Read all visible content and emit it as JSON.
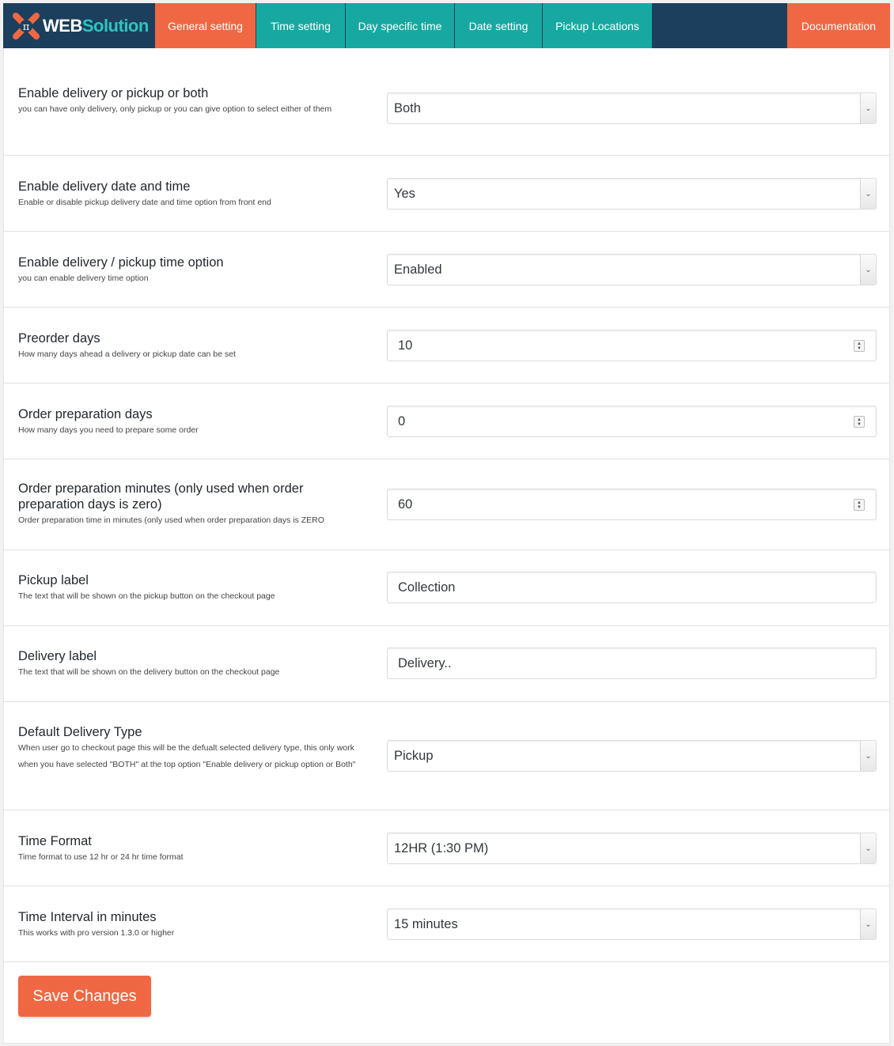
{
  "brand": {
    "part1": "WEB",
    "part2": "Solution"
  },
  "tabs": [
    {
      "label": "General setting"
    },
    {
      "label": "Time setting"
    },
    {
      "label": "Day specific time"
    },
    {
      "label": "Date setting"
    },
    {
      "label": "Pickup Locations"
    }
  ],
  "doc_tab": "Documentation",
  "settings": {
    "delivery_mode": {
      "title": "Enable delivery or pickup or both",
      "desc": "you can have only delivery, only pickup or you can give option to select either of them",
      "value": "Both"
    },
    "date_time": {
      "title": "Enable delivery date and time",
      "desc": "Enable or disable pickup delivery date and time option from front end",
      "value": "Yes"
    },
    "time_option": {
      "title": "Enable delivery / pickup time option",
      "desc": "you can enable delivery time option",
      "value": "Enabled"
    },
    "preorder": {
      "title": "Preorder days",
      "desc": "How many days ahead a delivery or pickup date can be set",
      "value": "10"
    },
    "prep_days": {
      "title": "Order preparation days",
      "desc": "How many days you need to prepare some order",
      "value": "0"
    },
    "prep_minutes": {
      "title": "Order preparation minutes (only used when order preparation days is zero)",
      "desc": "Order preparation time in minutes (only used when order preparation days is ZERO",
      "value": "60"
    },
    "pickup_label": {
      "title": "Pickup label",
      "desc": "The text that will be shown on the pickup button on the checkout page",
      "value": "Collection"
    },
    "delivery_label": {
      "title": "Delivery label",
      "desc": "The text that will be shown on the delivery button on the checkout page",
      "value": "Delivery.."
    },
    "default_type": {
      "title": "Default Delivery Type",
      "desc": "When user go to checkout page this will be the defualt selected delivery type, this only work when you have selected \"BOTH\" at the top option \"Enable delivery or pickup option or Both\"",
      "value": "Pickup"
    },
    "time_format": {
      "title": "Time Format",
      "desc": "Time format to use 12 hr or 24 hr time format",
      "value": "12HR (1:30 PM)"
    },
    "time_interval": {
      "title": "Time Interval in minutes",
      "desc": "This works with pro version 1.3.0 or higher",
      "value": "15 minutes"
    }
  },
  "save_label": "Save Changes",
  "colors": {
    "navy": "#1b3f5c",
    "orange": "#ef6843",
    "teal": "#17a9a1"
  }
}
